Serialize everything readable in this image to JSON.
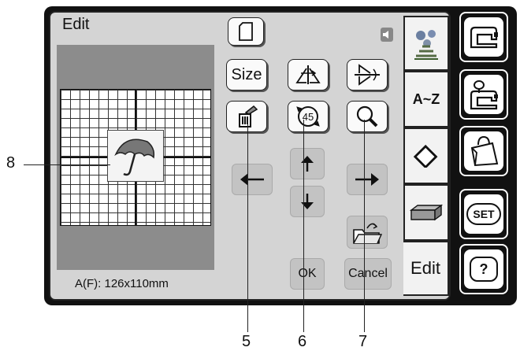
{
  "screen": {
    "title": "Edit",
    "size_readout": "A(F): 126x110mm"
  },
  "buttons": {
    "size_label": "Size",
    "ok_label": "OK",
    "cancel_label": "Cancel"
  },
  "tabs": [
    {
      "name": "embroidery-design",
      "label": ""
    },
    {
      "name": "letters",
      "label": "A~Z"
    },
    {
      "name": "eraser",
      "label": ""
    },
    {
      "name": "frame",
      "label": ""
    },
    {
      "name": "edit",
      "label": "Edit"
    }
  ],
  "side_buttons": [
    {
      "name": "sewing-mode",
      "label": ""
    },
    {
      "name": "embroidery-mode",
      "label": ""
    },
    {
      "name": "bag",
      "label": ""
    },
    {
      "name": "set",
      "label": "SET"
    },
    {
      "name": "help",
      "label": "?"
    }
  ],
  "callouts": {
    "c5": "5",
    "c6": "6",
    "c7": "7",
    "c8": "8"
  },
  "icons": [
    "new-pattern-icon",
    "mirror-icon",
    "flip-icon",
    "delete-icon",
    "rotate-45-icon",
    "zoom-icon",
    "arrow-up-icon",
    "arrow-down-icon",
    "arrow-left-icon",
    "arrow-right-icon",
    "folder-icon",
    "speaker-icon",
    "umbrella-icon"
  ],
  "rotate_label": "45"
}
